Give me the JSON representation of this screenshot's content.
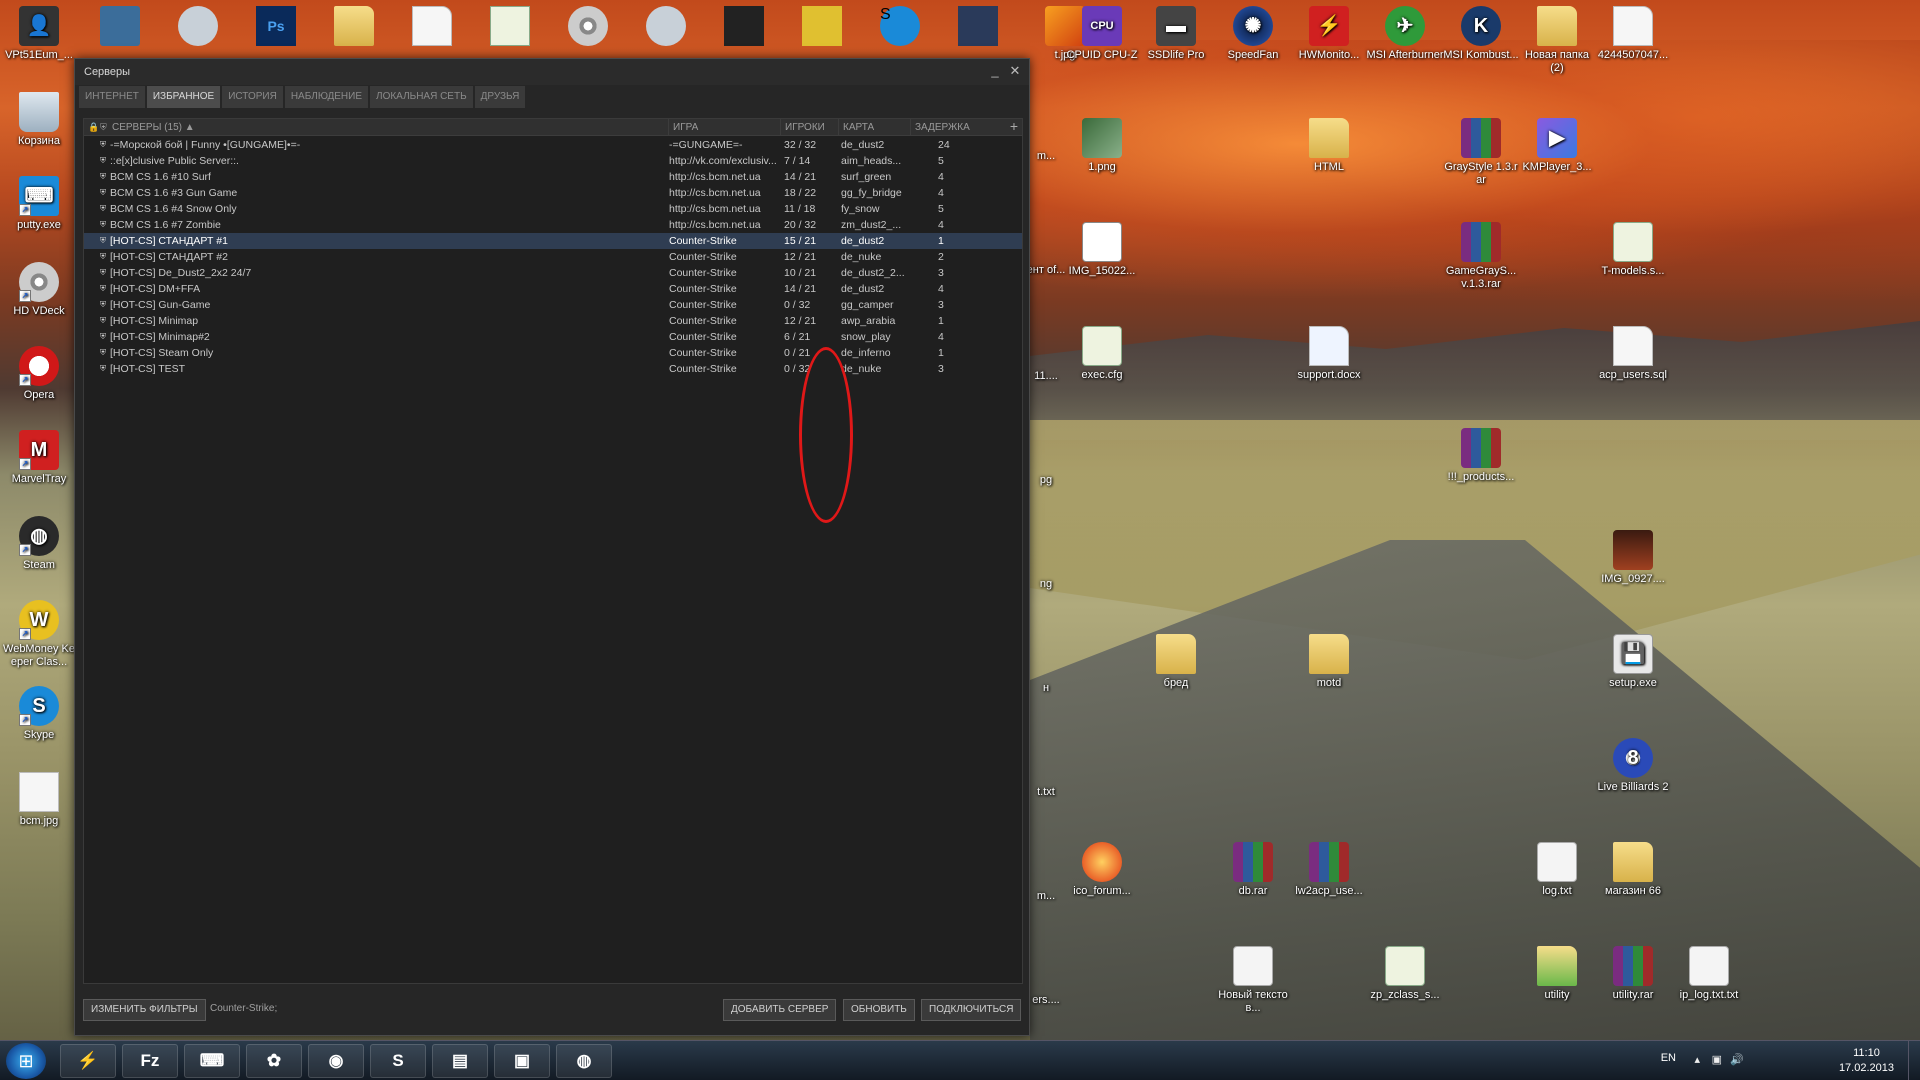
{
  "window": {
    "title": "Серверы",
    "minimize": "_",
    "close": "✕",
    "tabs": [
      "ИНТЕРНЕТ",
      "ИЗБРАННОЕ",
      "ИСТОРИЯ",
      "НАБЛЮДЕНИЕ",
      "ЛОКАЛЬНАЯ СЕТЬ",
      "ДРУЗЬЯ"
    ],
    "active_tab": "ИЗБРАННОЕ",
    "columns": {
      "servers": "СЕРВЕРЫ (15) ▲",
      "game": "ИГРА",
      "players": "ИГРОКИ",
      "map": "КАРТА",
      "ping": "ЗАДЕРЖКА",
      "add": "+"
    },
    "rows": [
      {
        "name": "-=Морской бой | Funny •[GUNGAME]•=-",
        "game": "-=GUNGAME=-",
        "players": "32 / 32",
        "map": "de_dust2",
        "ping": "24"
      },
      {
        "name": "::e[x]clusive Public Server::.",
        "game": "http://vk.com/exclusiv...",
        "players": "7 / 14",
        "map": "aim_heads...",
        "ping": "5"
      },
      {
        "name": "BCM CS 1.6 #10 Surf",
        "game": "http://cs.bcm.net.ua",
        "players": "14 / 21",
        "map": "surf_green",
        "ping": "4"
      },
      {
        "name": "BCM CS 1.6 #3 Gun Game",
        "game": "http://cs.bcm.net.ua",
        "players": "18 / 22",
        "map": "gg_fy_bridge",
        "ping": "4"
      },
      {
        "name": "BCM CS 1.6 #4 Snow Only",
        "game": "http://cs.bcm.net.ua",
        "players": "11 / 18",
        "map": "fy_snow",
        "ping": "5"
      },
      {
        "name": "BCM CS 1.6 #7 Zombie",
        "game": "http://cs.bcm.net.ua",
        "players": "20 / 32",
        "map": "zm_dust2_...",
        "ping": "4"
      },
      {
        "name": "[HOT-CS] СТАНДАРТ #1",
        "game": "Counter-Strike",
        "players": "15 / 21",
        "map": "de_dust2",
        "ping": "1",
        "selected": true
      },
      {
        "name": "[HOT-CS] СТАНДАРТ #2",
        "game": "Counter-Strike",
        "players": "12 / 21",
        "map": "de_nuke",
        "ping": "2"
      },
      {
        "name": "[HOT-CS] De_Dust2_2x2 24/7",
        "game": "Counter-Strike",
        "players": "10 / 21",
        "map": "de_dust2_2...",
        "ping": "3"
      },
      {
        "name": "[HOT-CS] DM+FFA",
        "game": "Counter-Strike",
        "players": "14 / 21",
        "map": "de_dust2",
        "ping": "4"
      },
      {
        "name": "[HOT-CS] Gun-Game",
        "game": "Counter-Strike",
        "players": "0 / 32",
        "map": "gg_camper",
        "ping": "3"
      },
      {
        "name": "[HOT-CS] Minimap",
        "game": "Counter-Strike",
        "players": "12 / 21",
        "map": "awp_arabia",
        "ping": "1"
      },
      {
        "name": "[HOT-CS] Minimap#2",
        "game": "Counter-Strike",
        "players": "6 / 21",
        "map": "snow_play",
        "ping": "4"
      },
      {
        "name": "[HOT-CS] Steam Only",
        "game": "Counter-Strike",
        "players": "0 / 21",
        "map": "de_inferno",
        "ping": "1"
      },
      {
        "name": "[HOT-CS] TEST",
        "game": "Counter-Strike",
        "players": "0 / 32",
        "map": "de_nuke",
        "ping": "3"
      }
    ],
    "buttons": {
      "filters": "ИЗМЕНИТЬ ФИЛЬТРЫ",
      "filter_text": "Counter-Strike;",
      "add_server": "ДОБАВИТЬ СЕРВЕР",
      "refresh": "ОБНОВИТЬ",
      "connect": "ПОДКЛЮЧИТЬСЯ"
    },
    "colors": {
      "selected_row": "#2f3d52",
      "annotation": "#e01818"
    }
  },
  "desktop": {
    "left_column": [
      "VPt51Eum_...",
      "Корзина",
      "putty.exe",
      "HD VDeck",
      "Opera",
      "MarvelTray",
      "Steam",
      "WebMoney Keeper Clas...",
      "Skype",
      "bcm.jpg"
    ],
    "top_row": [
      "t.jpg",
      "CPUID CPU-Z",
      "SSDlife Pro",
      "SpeedFan",
      "HWMonito...",
      "MSI Afterburner",
      "MSI Kombust...",
      "Новая папка (2)",
      "4244507047..."
    ],
    "icons": {
      "m": "m...",
      "png1": "1.png",
      "html": "HTML",
      "graystyle": "GrayStyle 1.3.rar",
      "kmplayer": "KMPlayer_3...",
      "ent": "ент of...",
      "img15022": "IMG_15022...",
      "gamegrays": "GameGrayS... v.1.3.rar",
      "tmodels": "T-models.s...",
      "eleven": "11....",
      "execcfg": "exec.cfg",
      "support": "support.docx",
      "acpusers": "acp_users.sql",
      "pg": "pg",
      "products": "!!!_products...",
      "ng": "ng",
      "img0927": "IMG_0927....",
      "n": "н",
      "bred": "бред",
      "motd": "motd",
      "setup": "setup.exe",
      "t1": "t.txt",
      "billiards": "Live Billiards 2",
      "m2": "m...",
      "icoforum": "ico_forum...",
      "dbrar": "db.rar",
      "lw2acp": "lw2acp_use...",
      "logtxt": "log.txt",
      "magazin": "магазин 66",
      "ers": "ers....",
      "noviy": "Новый текстов...",
      "zpzclass": "zp_zclass_s...",
      "utility": "utility",
      "utilityrar": "utility.rar",
      "iplog": "ip_log.txt.txt"
    }
  },
  "taskbar": {
    "start": "⊞",
    "items": [
      "HWMonitor",
      "FileZilla",
      "PuTTY",
      "ICQ",
      "Firefox",
      "Skype",
      "Explorer",
      "Server",
      "Steam"
    ],
    "item_glyphs": [
      "⚡",
      "Fz",
      "⌨",
      "✿",
      "◉",
      "S",
      "▤",
      "▣",
      "◍"
    ],
    "lang": "EN",
    "time": "11:10",
    "date": "17.02.2013"
  }
}
